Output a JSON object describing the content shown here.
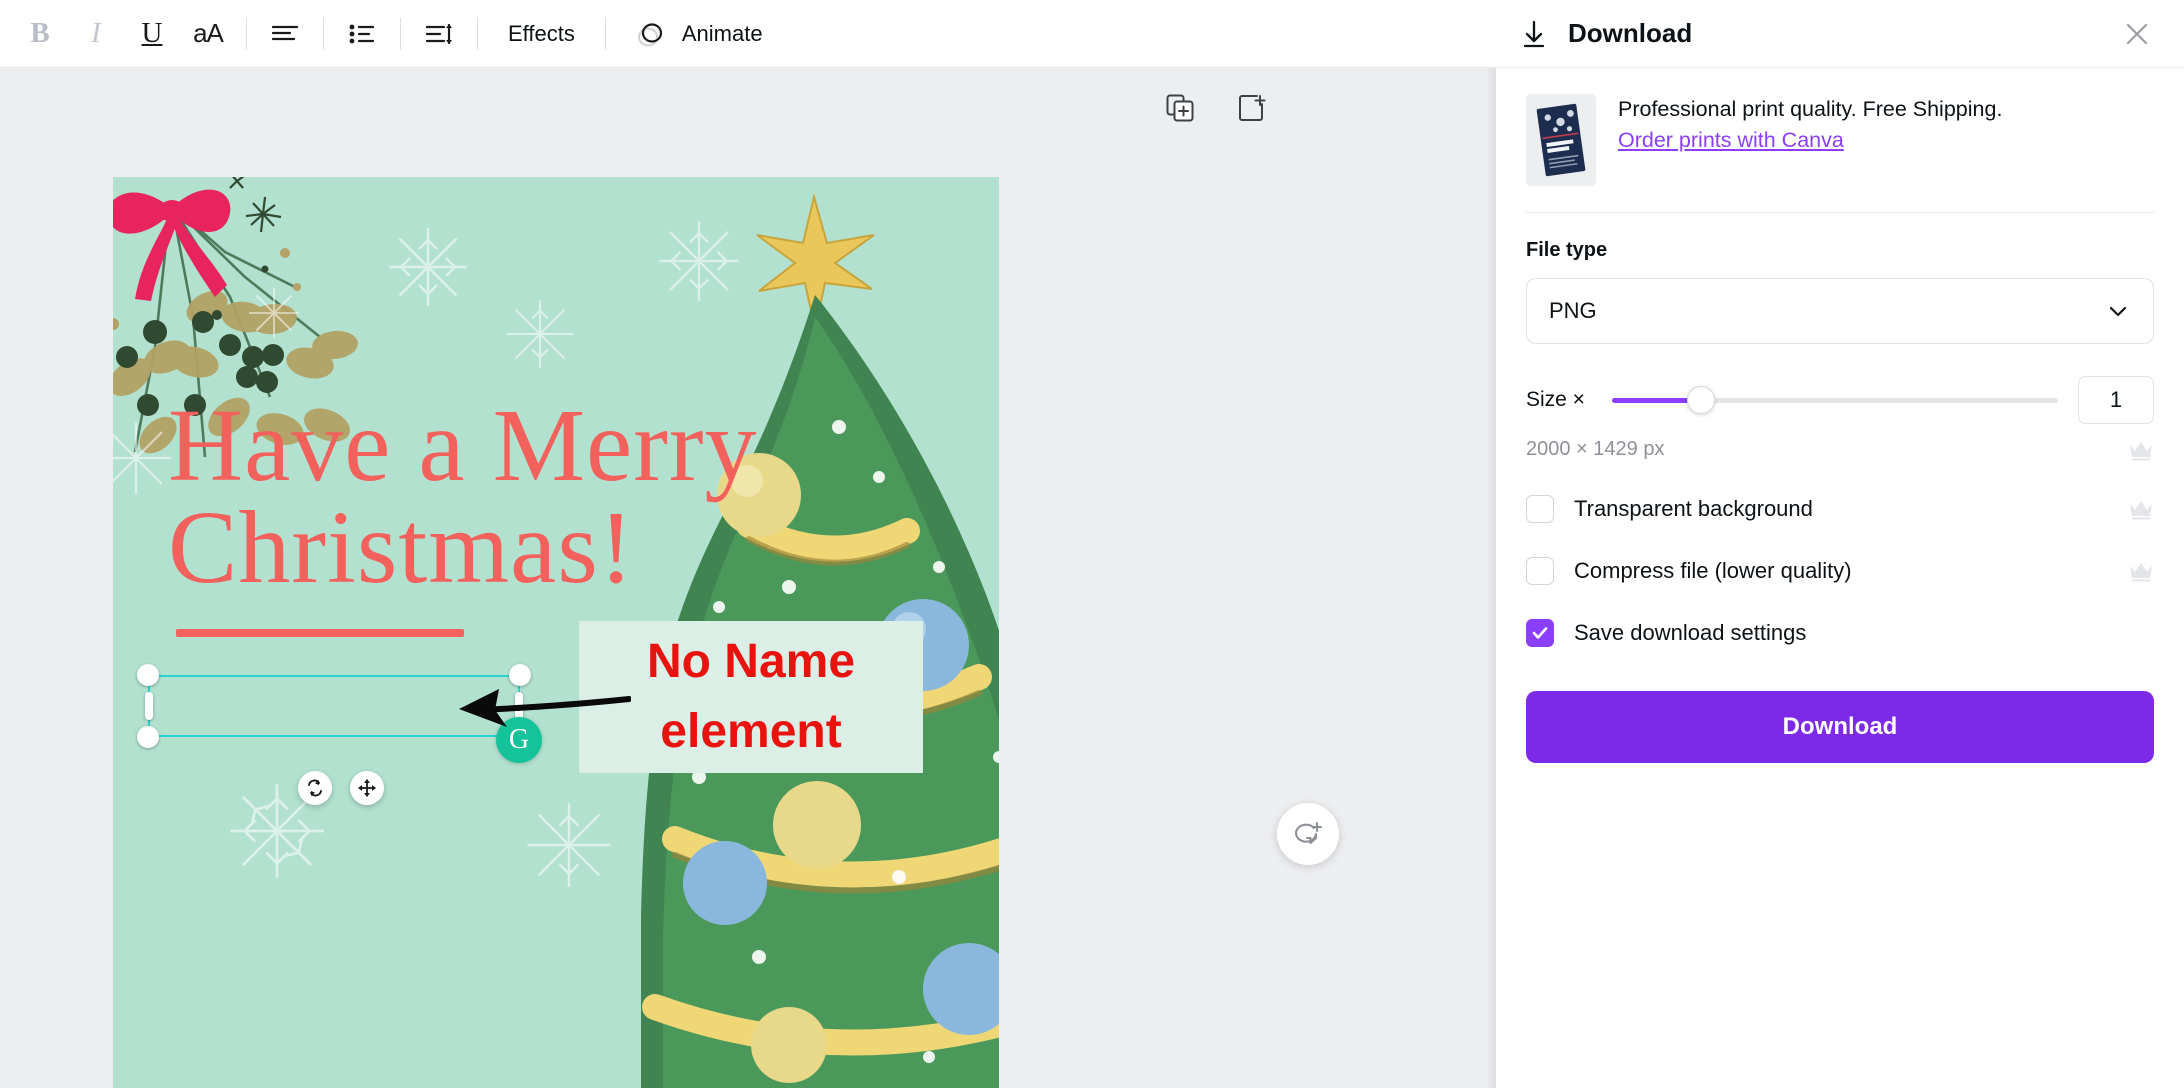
{
  "toolbar": {
    "bold_label": "B",
    "italic_label": "I",
    "underline_label": "U",
    "case_label": "aA",
    "effects_label": "Effects",
    "animate_label": "Animate"
  },
  "canvas": {
    "background_color": "#b2e1cf",
    "headline_line1": "Have a Merry",
    "headline_line2": "Christmas!",
    "headline_color": "#f2615c",
    "selection_color": "#2ad2d2",
    "grammarly_letter": "G",
    "grammarly_color": "#15c39a"
  },
  "annotation": {
    "line1": "No Name",
    "line2": "element",
    "text_color": "#e8130f",
    "background_color": "#dcefe7"
  },
  "panel": {
    "title": "Download",
    "promo": {
      "text": "Professional print quality. Free Shipping.",
      "link": "Order prints with Canva",
      "link_color": "#8b3ffd"
    },
    "file_type": {
      "label": "File type",
      "value": "PNG"
    },
    "size": {
      "label": "Size ×",
      "value": "1",
      "dimensions": "2000 × 1429 px",
      "slider_percent": 20,
      "accent_color": "#8b3ffd"
    },
    "options": [
      {
        "label": "Transparent background",
        "checked": false,
        "premium": true
      },
      {
        "label": "Compress file (lower quality)",
        "checked": false,
        "premium": true
      },
      {
        "label": "Save download settings",
        "checked": true,
        "premium": false
      }
    ],
    "download_button": "Download",
    "download_button_color": "#7d2ae8"
  }
}
